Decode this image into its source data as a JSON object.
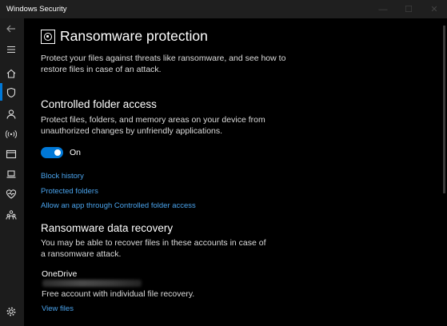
{
  "window": {
    "title": "Windows Security"
  },
  "sidebar": {
    "items": [
      {
        "icon": "back-arrow-icon"
      },
      {
        "icon": "hamburger-menu-icon"
      },
      {
        "icon": "home-icon"
      },
      {
        "icon": "shield-icon",
        "active": true
      },
      {
        "icon": "person-icon"
      },
      {
        "icon": "wireless-network-icon"
      },
      {
        "icon": "app-browser-icon"
      },
      {
        "icon": "laptop-icon"
      },
      {
        "icon": "heart-health-icon"
      },
      {
        "icon": "family-icon"
      },
      {
        "icon": "settings-gear-icon"
      }
    ]
  },
  "page": {
    "title": "Ransomware protection",
    "description": "Protect your files against threats like ransomware, and see how to restore files in case of an attack."
  },
  "controlled_folder": {
    "heading": "Controlled folder access",
    "description": "Protect files, folders, and memory areas on your device from unauthorized changes by unfriendly applications.",
    "toggle_state": "On",
    "toggle_on": true,
    "links": [
      "Block history",
      "Protected folders",
      "Allow an app through Controlled folder access"
    ]
  },
  "recovery": {
    "heading": "Ransomware data recovery",
    "description": "You may be able to recover files in these accounts in case of a ransomware attack.",
    "service_name": "OneDrive",
    "account_note": "Free account with individual file recovery.",
    "view_files": "View files"
  },
  "colors": {
    "accent": "#0078d7",
    "link": "#4aa3ec",
    "background": "#000000",
    "sidebar": "#1c1c1c"
  }
}
